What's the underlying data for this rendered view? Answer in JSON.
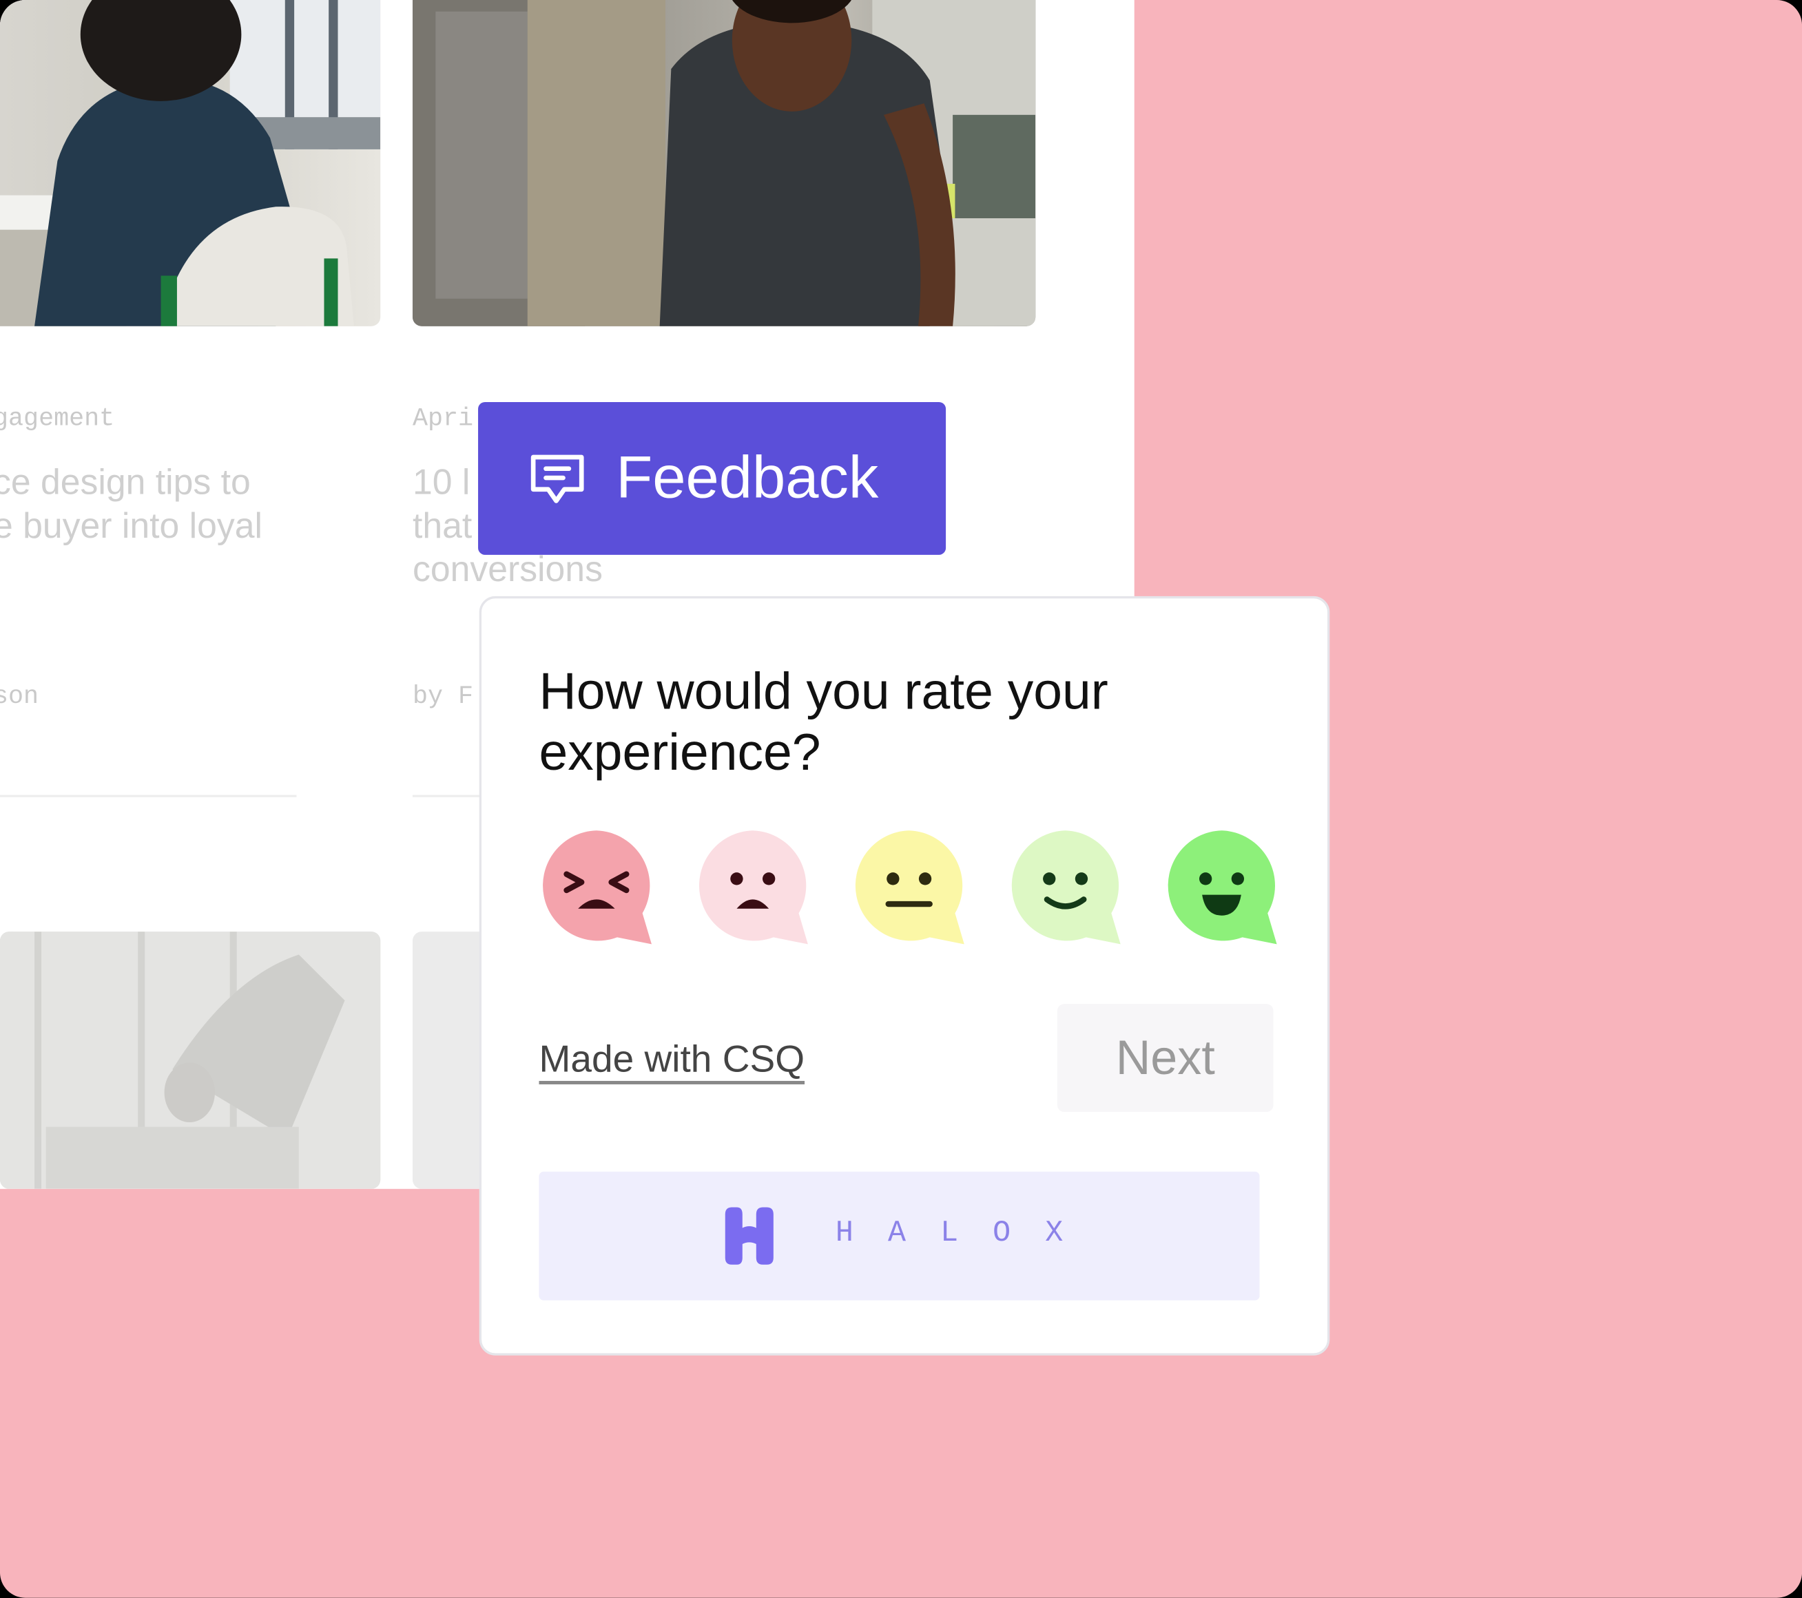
{
  "background": {
    "color": "#f8b4bc"
  },
  "articles": [
    {
      "category": "gagement",
      "title_lines": [
        "ce design tips to",
        "e buyer into loyal"
      ],
      "byline": "son"
    },
    {
      "category": "Apri",
      "title_lines": [
        "10 l",
        "that",
        "conversions"
      ],
      "byline": "by F"
    }
  ],
  "feedback_tab": {
    "label": "Feedback",
    "color": "#5b4fd9",
    "icon": "chat-icon"
  },
  "survey": {
    "question": "How would you rate your experience?",
    "ratings": [
      {
        "name": "very-unhappy",
        "icon": "angry-face-icon",
        "color": "#f4a3ac"
      },
      {
        "name": "unhappy",
        "icon": "sad-face-icon",
        "color": "#fbdde2"
      },
      {
        "name": "neutral",
        "icon": "neutral-face-icon",
        "color": "#fbf7a6"
      },
      {
        "name": "happy",
        "icon": "smile-face-icon",
        "color": "#ddf8c4"
      },
      {
        "name": "very-happy",
        "icon": "grin-face-icon",
        "color": "#8df07a"
      }
    ],
    "made_with": "Made with CSQ",
    "next_label": "Next",
    "brand": {
      "wordmark": "HALOX",
      "icon": "halox-logo-icon",
      "accent": "#7b6cf0"
    }
  }
}
